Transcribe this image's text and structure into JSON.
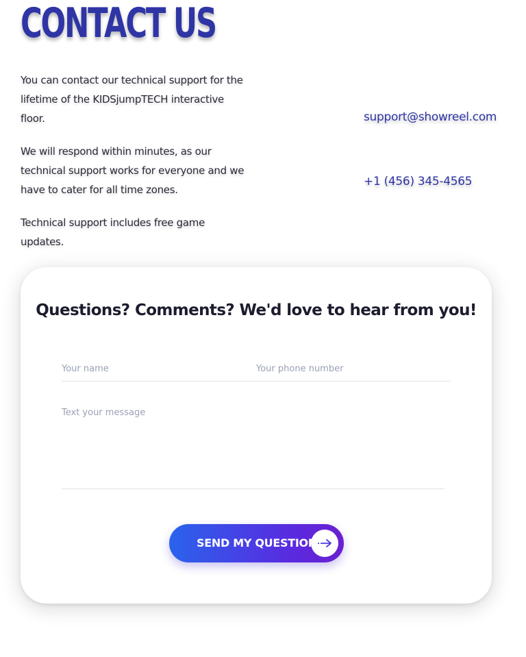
{
  "header": {
    "title": "CONTACT US"
  },
  "intro": {
    "paragraphs": [
      "You can contact our technical support for the lifetime of the KIDSjumpTECH interactive floor.",
      "We will respond within minutes, as our technical support works for everyone and we have to cater for all time zones.",
      "Technical support includes free game updates."
    ]
  },
  "contacts": {
    "email": "support@showreel.com",
    "phone": "+1 (456) 345-4565"
  },
  "form": {
    "heading": "Questions? Comments? We'd love to hear from you!",
    "name_placeholder": "Your name",
    "phone_placeholder": "Your phone number",
    "message_placeholder": "Text your message",
    "submit_label": "SEND MY QUESTION",
    "submit_icon": "arrow-right-icon"
  },
  "colors": {
    "brand_blue": "#2f35a5",
    "button_gradient_start": "#2a63ec",
    "button_gradient_end": "#6a1fd0"
  }
}
